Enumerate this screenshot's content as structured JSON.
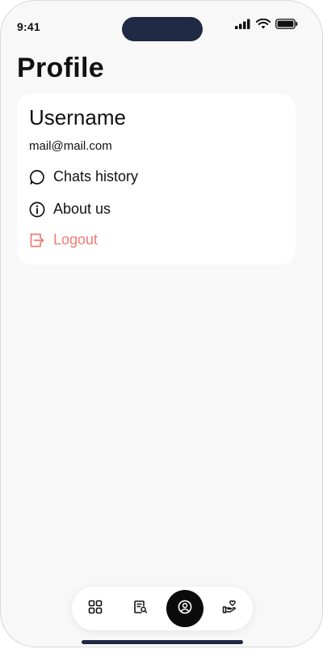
{
  "status_bar": {
    "time": "9:41",
    "icons": [
      "signal-icon",
      "wifi-icon",
      "battery-icon"
    ]
  },
  "page": {
    "title": "Profile"
  },
  "profile_card": {
    "username": "Username",
    "email": "mail@mail.com",
    "items": [
      {
        "label": "Chats history",
        "icon": "chat-bubble-icon"
      },
      {
        "label": "About us",
        "icon": "info-icon"
      },
      {
        "label": "Logout",
        "icon": "logout-icon"
      }
    ]
  },
  "tab_bar": {
    "tabs": [
      {
        "icon": "grid-icon",
        "active": false
      },
      {
        "icon": "document-search-icon",
        "active": false
      },
      {
        "icon": "user-circle-icon",
        "active": true
      },
      {
        "icon": "hand-heart-icon",
        "active": false
      }
    ]
  },
  "colors": {
    "background": "#f8f8f8",
    "card": "#ffffff",
    "logout": "#f07b73",
    "active_tab": "#0b0b0b",
    "island": "#1f2a44"
  }
}
